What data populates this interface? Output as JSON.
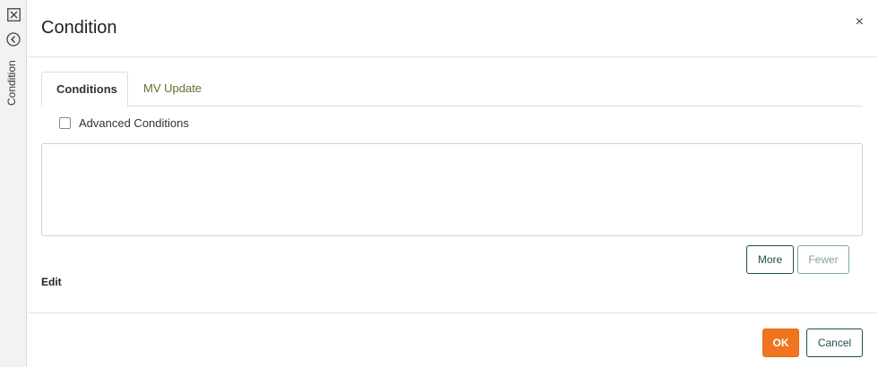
{
  "side_strip": {
    "label": "Condition",
    "icons": [
      "close-box-icon",
      "back-circle-icon"
    ]
  },
  "panel": {
    "title": "Condition",
    "close_glyph": "×"
  },
  "tabs": [
    {
      "label": "Conditions",
      "active": true
    },
    {
      "label": "MV Update",
      "active": false
    }
  ],
  "advanced": {
    "label": "Advanced Conditions",
    "checked": false
  },
  "conditions_box": {
    "value": ""
  },
  "row_buttons": {
    "more_label": "More",
    "fewer_label": "Fewer"
  },
  "edit_label": "Edit",
  "footer": {
    "ok_label": "OK",
    "cancel_label": "Cancel"
  },
  "colors": {
    "accent_orange": "#ef7521",
    "dark_teal": "#1e4f4f",
    "tab_inactive_text": "#6b6b2e"
  }
}
